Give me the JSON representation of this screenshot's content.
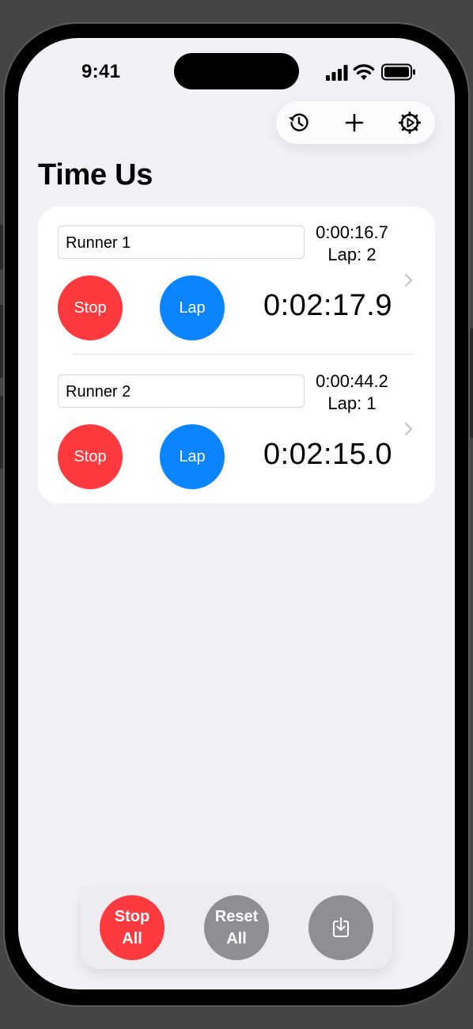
{
  "status_bar": {
    "time": "9:41"
  },
  "toolbar": {
    "history_icon": "history-icon",
    "add_icon": "plus-icon",
    "settings_icon": "gear-icon"
  },
  "page": {
    "title": "Time Us"
  },
  "runners": [
    {
      "name": "Runner 1",
      "lap_time": "0:00:16.7",
      "lap_count": "Lap: 2",
      "stop_label": "Stop",
      "lap_label": "Lap",
      "total_time": "0:02:17.9"
    },
    {
      "name": "Runner 2",
      "lap_time": "0:00:44.2",
      "lap_count": "Lap: 1",
      "stop_label": "Stop",
      "lap_label": "Lap",
      "total_time": "0:02:15.0"
    }
  ],
  "bottom_bar": {
    "stop_all_line1": "Stop",
    "stop_all_line2": "All",
    "reset_all_line1": "Reset",
    "reset_all_line2": "All",
    "export_icon": "export-icon"
  },
  "colors": {
    "stop": "#fe3a3e",
    "lap": "#0a84ff",
    "disabled": "#8e8e93",
    "background": "#f1f1f6"
  }
}
